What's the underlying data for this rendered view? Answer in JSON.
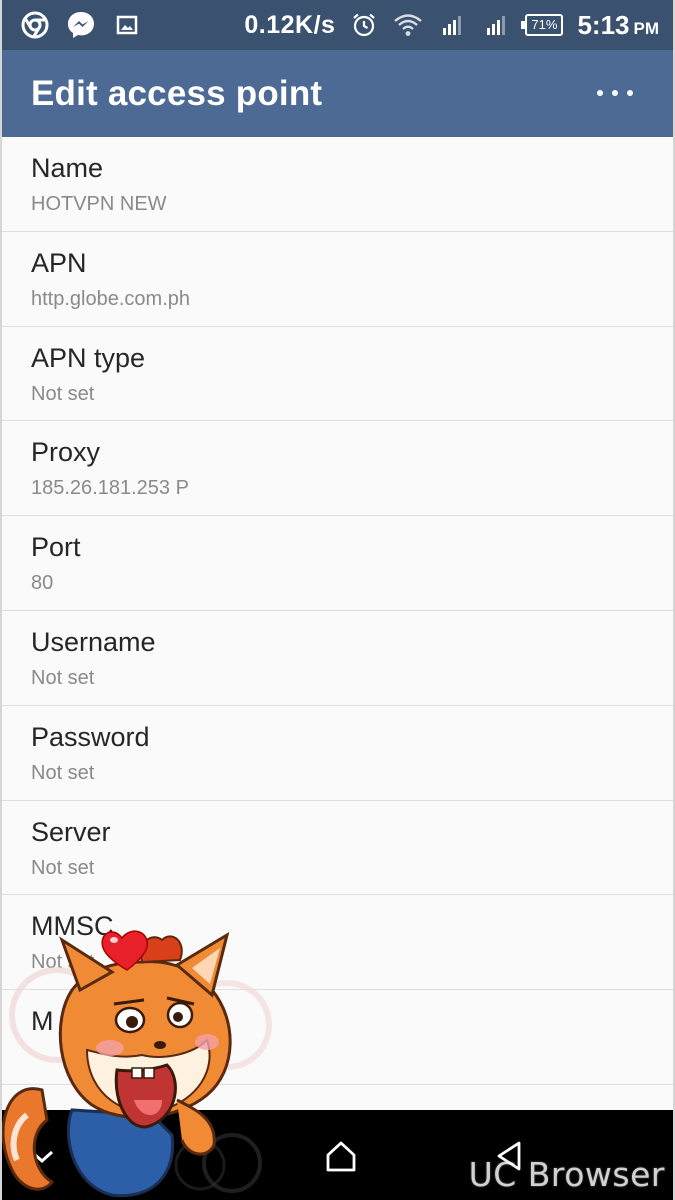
{
  "status_bar": {
    "net_speed": "0.12K/s",
    "battery": "71%",
    "time": "5:13",
    "ampm": "PM",
    "icons": [
      "chrome-icon",
      "messenger-icon",
      "gallery-icon",
      "alarm-icon",
      "wifi-icon",
      "signal-icon",
      "signal-icon",
      "battery-icon"
    ]
  },
  "app_bar": {
    "title": "Edit access point",
    "overflow_icon": "more-vert-icon"
  },
  "fields": [
    {
      "title": "Name",
      "value": "HOTVPN NEW"
    },
    {
      "title": "APN",
      "value": "http.globe.com.ph"
    },
    {
      "title": "APN type",
      "value": "Not set"
    },
    {
      "title": "Proxy",
      "value": "185.26.181.253 P"
    },
    {
      "title": "Port",
      "value": "80"
    },
    {
      "title": "Username",
      "value": "Not set"
    },
    {
      "title": "Password",
      "value": "Not set"
    },
    {
      "title": "Server",
      "value": "Not set"
    },
    {
      "title": "MMSC",
      "value": "Not set"
    },
    {
      "title": "M",
      "value": ""
    },
    {
      "title": "",
      "value": ""
    }
  ],
  "nav_bar": {
    "icons": [
      "hide-keyboard-icon",
      "home-icon",
      "back-icon"
    ]
  },
  "overlay": {
    "brand": "UC Browser",
    "mascot": "squirrel-mascot"
  },
  "colors": {
    "status_bar": "#3b5170",
    "app_bar": "#4d6a95",
    "nav_bar": "#000000",
    "list_bg": "#fafafa"
  }
}
